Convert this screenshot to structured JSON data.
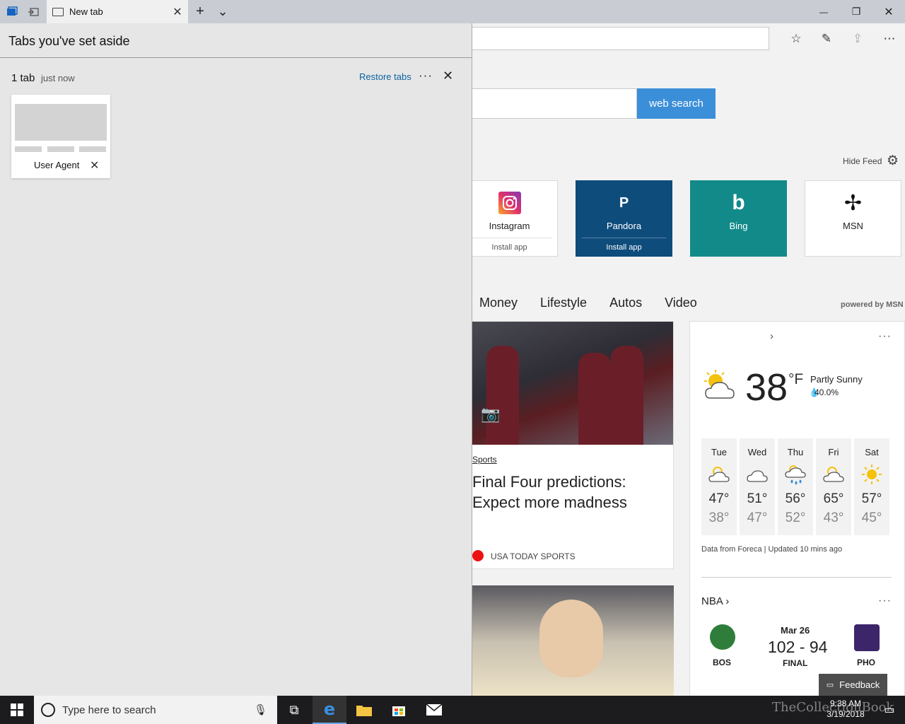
{
  "titlebar": {
    "tab_title": "New tab",
    "new_tab_symbol": "+",
    "tab_list_symbol": "⌄",
    "minimize_symbol": "—",
    "restore_symbol": "❐",
    "close_symbol": "✕"
  },
  "toolbar": {
    "favorites_icon": "☆",
    "notes_icon": "✎",
    "share_icon": "⇪",
    "more_icon": "⋯"
  },
  "search": {
    "button_label": "web search"
  },
  "feed": {
    "hide_label": "Hide Feed",
    "powered_by": "powered by MSN"
  },
  "top_sites": [
    {
      "name": "Instagram",
      "sub": "Install app",
      "bg": "#ffffff",
      "fg": "#222222"
    },
    {
      "name": "Pandora",
      "sub": "Install app",
      "bg": "#0e4c7c",
      "fg": "#ffffff",
      "logo": "P"
    },
    {
      "name": "Bing",
      "sub": "",
      "bg": "#138a8a",
      "fg": "#ffffff",
      "logo": "b"
    },
    {
      "name": "MSN",
      "sub": "",
      "bg": "#ffffff",
      "fg": "#222222",
      "logo": "✢"
    }
  ],
  "nav_categories": [
    "Money",
    "Lifestyle",
    "Autos",
    "Video"
  ],
  "news": {
    "category": "Sports",
    "headline": "Final Four predictions: Expect more madness",
    "source": "USA TODAY SPORTS"
  },
  "weather": {
    "temp": "38",
    "unit": "°F",
    "condition": "Partly Sunny",
    "precip": "40.0%",
    "credit": "Data from Foreca | Updated 10 mins ago",
    "forecast": [
      {
        "day": "Tue",
        "hi": "47°",
        "lo": "38°",
        "icon": "partly-sunny-icon"
      },
      {
        "day": "Wed",
        "hi": "51°",
        "lo": "47°",
        "icon": "cloudy-icon"
      },
      {
        "day": "Thu",
        "hi": "56°",
        "lo": "52°",
        "icon": "rain-icon"
      },
      {
        "day": "Fri",
        "hi": "65°",
        "lo": "43°",
        "icon": "partly-sunny-icon"
      },
      {
        "day": "Sat",
        "hi": "57°",
        "lo": "45°",
        "icon": "sunny-icon"
      }
    ]
  },
  "nba": {
    "title": "NBA",
    "date": "Mar 26",
    "score": "102 - 94",
    "status": "FINAL",
    "home": "BOS",
    "away": "PHO"
  },
  "feedback_label": "Feedback",
  "aside": {
    "title": "Tabs you've set aside",
    "count": "1 tab",
    "time": "just now",
    "restore": "Restore tabs",
    "tab_label": "User Agent"
  },
  "taskbar": {
    "search_placeholder": "Type here to search",
    "time": "9:38 AM",
    "date": "3/19/2018",
    "watermark": "TheCollectionBook"
  }
}
